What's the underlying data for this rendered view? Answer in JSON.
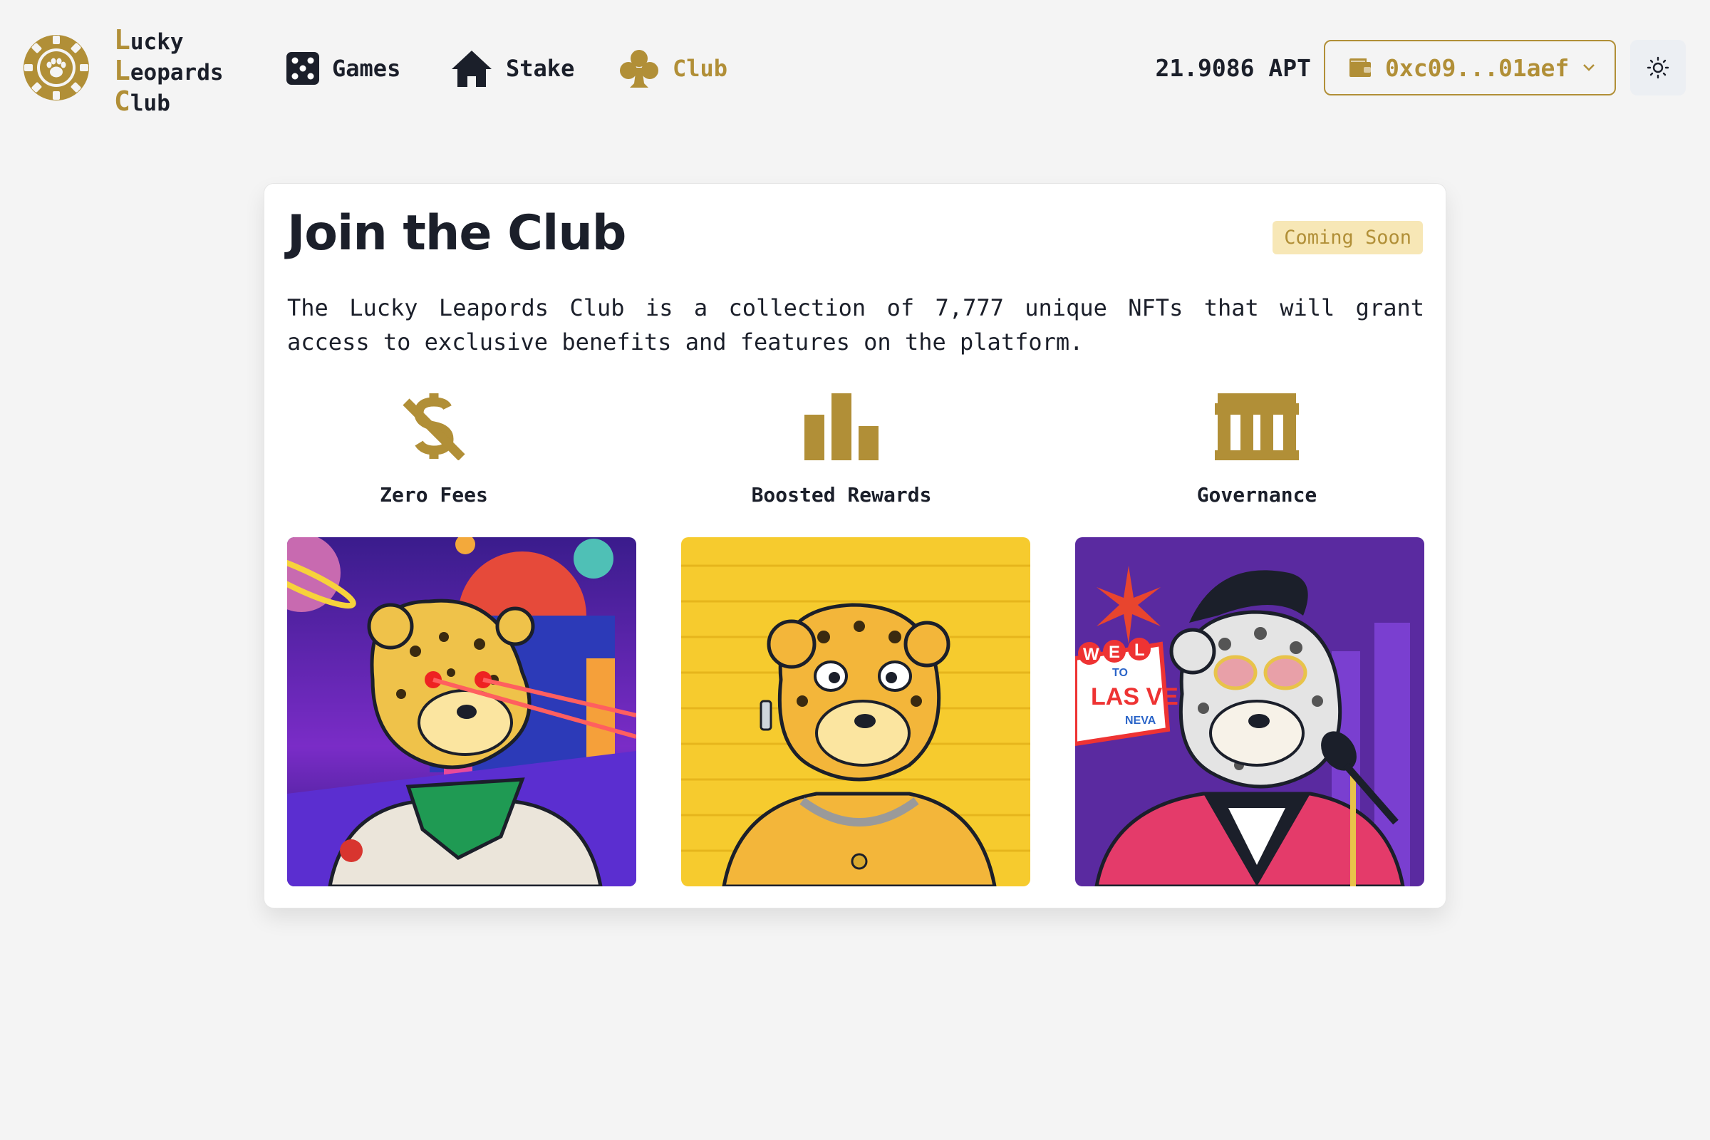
{
  "brand": {
    "lines": [
      {
        "cap": "L",
        "rest": "ucky"
      },
      {
        "cap": "L",
        "rest": "eopards"
      },
      {
        "cap": "C",
        "rest": "lub"
      }
    ]
  },
  "nav": {
    "games": "Games",
    "stake": "Stake",
    "club": "Club"
  },
  "account": {
    "balance": "21.9086 APT",
    "wallet": "0xc09...01aef"
  },
  "club": {
    "title": "Join the Club",
    "badge": "Coming Soon",
    "description": "The Lucky Leapords Club is a collection of 7,777 unique NFTs that will grant access to exclusive benefits and features on the platform.",
    "features": [
      {
        "label": "Zero Fees",
        "icon": "no-dollar-icon"
      },
      {
        "label": "Boosted Rewards",
        "icon": "bar-chart-icon"
      },
      {
        "label": "Governance",
        "icon": "bank-icon"
      }
    ],
    "nft_sign": {
      "welcome_letters": "WEL",
      "to": "TO",
      "las": "LAS VE",
      "nevada": "NEVA"
    }
  },
  "colors": {
    "accent": "#b18f37",
    "badge_bg": "#f7e7b6",
    "text": "#1b1f2a",
    "background": "#f4f4f4"
  }
}
